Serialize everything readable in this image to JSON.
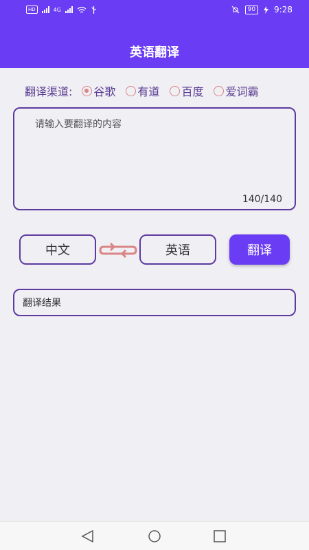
{
  "status_bar": {
    "hd_label": "HD",
    "network": "4G",
    "battery": "90",
    "time": "9:28"
  },
  "header": {
    "title": "英语翻译"
  },
  "channel": {
    "label": "翻译渠道:",
    "options": [
      {
        "label": "谷歌",
        "selected": true
      },
      {
        "label": "有道",
        "selected": false
      },
      {
        "label": "百度",
        "selected": false
      },
      {
        "label": "爱词霸",
        "selected": false
      }
    ]
  },
  "input": {
    "placeholder": "请输入要翻译的内容",
    "value": "",
    "counter": "140/140"
  },
  "languages": {
    "source": "中文",
    "target": "英语",
    "swap_icon": "swap-arrows-icon",
    "swap_color": "#d98585"
  },
  "translate_button": {
    "label": "翻译"
  },
  "result": {
    "placeholder": "翻译结果"
  },
  "colors": {
    "primary": "#6a3cf4",
    "border": "#5e3aa0",
    "background": "#f0eff4"
  },
  "nav_bar": {
    "back_icon": "back-triangle-icon",
    "home_icon": "home-circle-icon",
    "recents_icon": "recents-square-icon"
  }
}
